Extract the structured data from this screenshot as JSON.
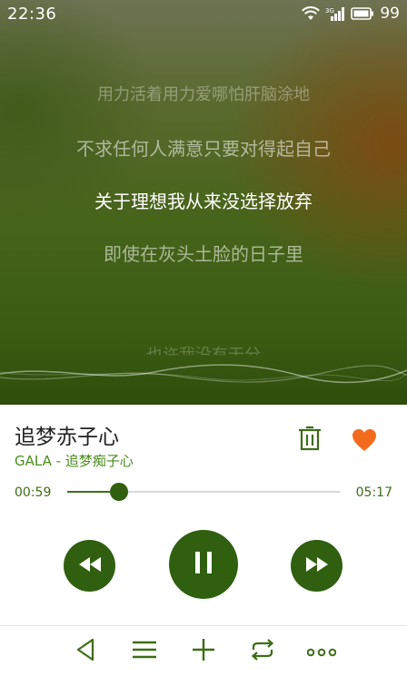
{
  "status": {
    "time": "22:36",
    "network": "3G",
    "battery": "99"
  },
  "lyrics": {
    "lines": [
      "用力活着用力爱哪怕肝脑涂地",
      "不求任何人满意只要对得起自己",
      "关于理想我从来没选择放弃",
      "即使在灰头土脸的日子里",
      "也许我没有天分"
    ]
  },
  "player": {
    "title": "追梦赤子心",
    "artist_album": "GALA - 追梦痴子心",
    "current_time": "00:59",
    "total_time": "05:17",
    "progress": 0.19
  },
  "colors": {
    "accent": "#2f5f0f",
    "heart": "#f26b1d",
    "text_green": "#4a8c1c"
  },
  "icons": [
    "wifi-icon",
    "signal-icon",
    "battery-icon",
    "trash-icon",
    "heart-icon",
    "rewind-icon",
    "pause-icon",
    "fast-forward-icon",
    "back-icon",
    "playlist-icon",
    "add-icon",
    "repeat-icon",
    "more-icon"
  ]
}
